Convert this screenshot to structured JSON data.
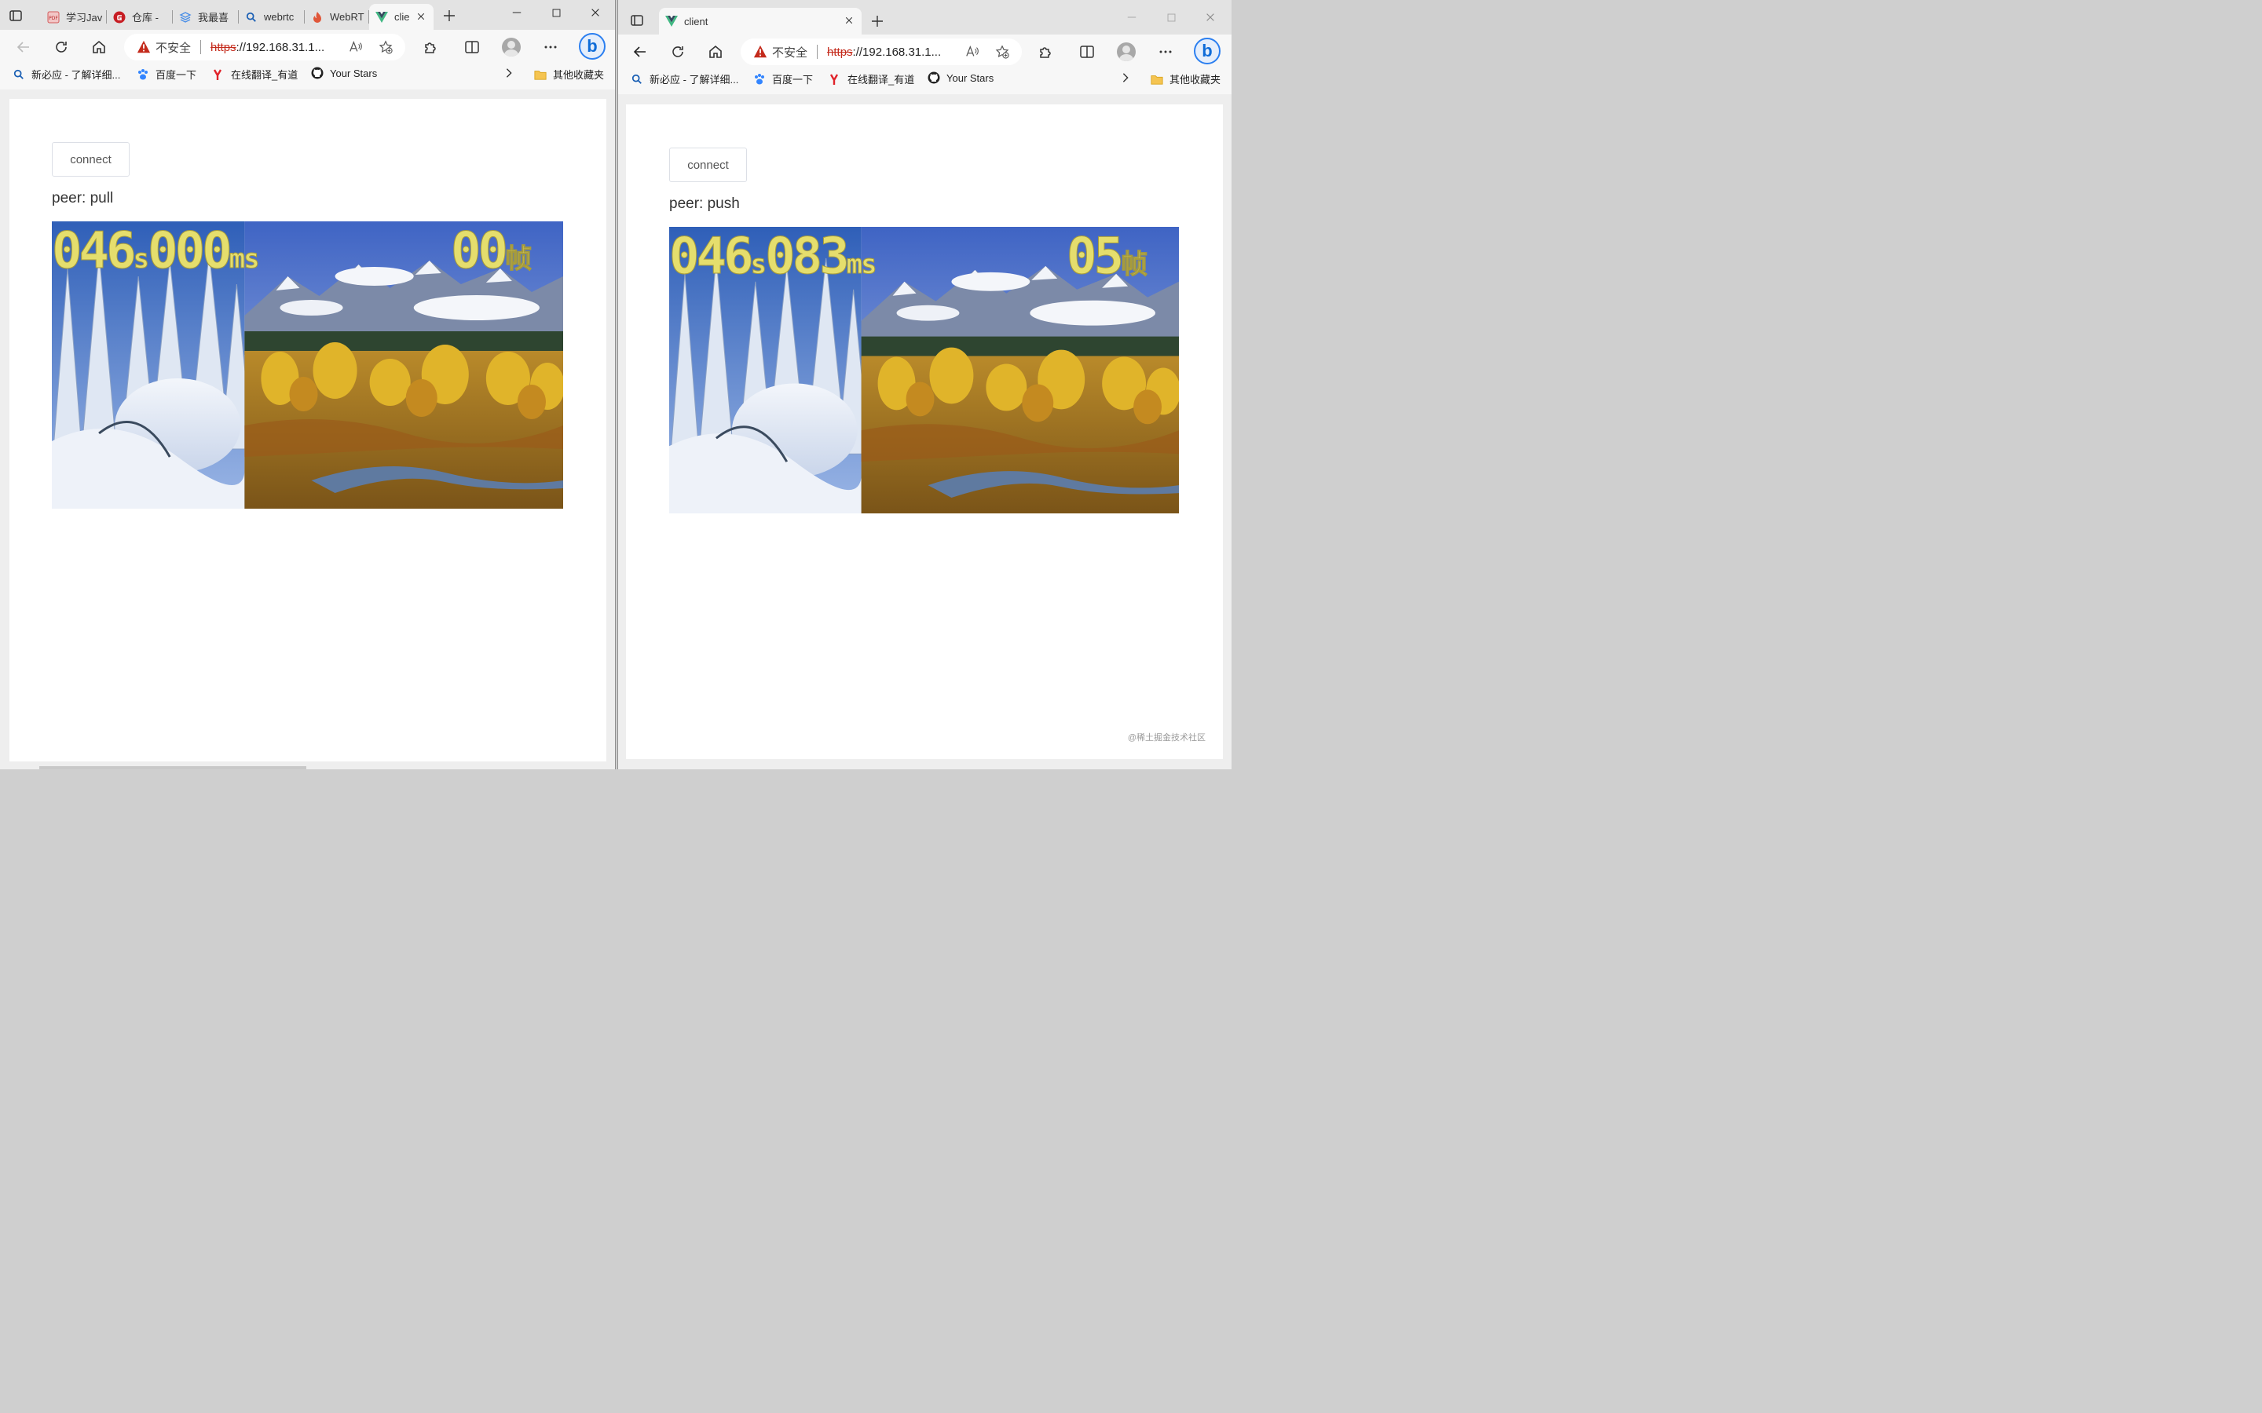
{
  "colors": {
    "accent": "#0f6cd8",
    "insecure": "#c42b1c",
    "overlay_text": "#e5de6d"
  },
  "left_window": {
    "tabs": [
      {
        "label": "学习Jav",
        "icon": "pdf-icon"
      },
      {
        "label": "仓库 - ",
        "icon": "gitee-icon"
      },
      {
        "label": "我最喜",
        "icon": "layers-icon"
      },
      {
        "label": "webrtc",
        "icon": "search-icon"
      },
      {
        "label": "WebRT",
        "icon": "flame-icon"
      },
      {
        "label": "clie",
        "icon": "vue-icon",
        "active": true
      }
    ],
    "address": {
      "security": "不安全",
      "scheme": "https",
      "rest": "://192.168.31.1..."
    },
    "favorites": [
      {
        "label": "新必应 - 了解详细...",
        "icon": "search-icon"
      },
      {
        "label": "百度一下",
        "icon": "baidu-paw-icon"
      },
      {
        "label": "在线翻译_有道",
        "icon": "youdao-icon"
      },
      {
        "label": "Your Stars",
        "icon": "github-icon"
      }
    ],
    "other_favorites": "其他收藏夹",
    "page": {
      "connect_label": "connect",
      "peer_label": "peer: pull",
      "overlay": {
        "seconds": "046",
        "s_unit": "s",
        "ms": "000",
        "ms_unit": "ms",
        "frames": "00",
        "frame_unit": "帧"
      }
    }
  },
  "right_window": {
    "tabs": [
      {
        "label": "client",
        "icon": "vue-icon",
        "active": true
      }
    ],
    "address": {
      "security": "不安全",
      "scheme": "https",
      "rest": "://192.168.31.1..."
    },
    "favorites": [
      {
        "label": "新必应 - 了解详细...",
        "icon": "search-icon"
      },
      {
        "label": "百度一下",
        "icon": "baidu-paw-icon"
      },
      {
        "label": "在线翻译_有道",
        "icon": "youdao-icon"
      },
      {
        "label": "Your Stars",
        "icon": "github-icon"
      }
    ],
    "other_favorites": "其他收藏夹",
    "page": {
      "connect_label": "connect",
      "peer_label": "peer: push",
      "overlay": {
        "seconds": "046",
        "s_unit": "s",
        "ms": "083",
        "ms_unit": "ms",
        "frames": "05",
        "frame_unit": "帧"
      }
    },
    "watermark": "@稀土掘金技术社区"
  }
}
